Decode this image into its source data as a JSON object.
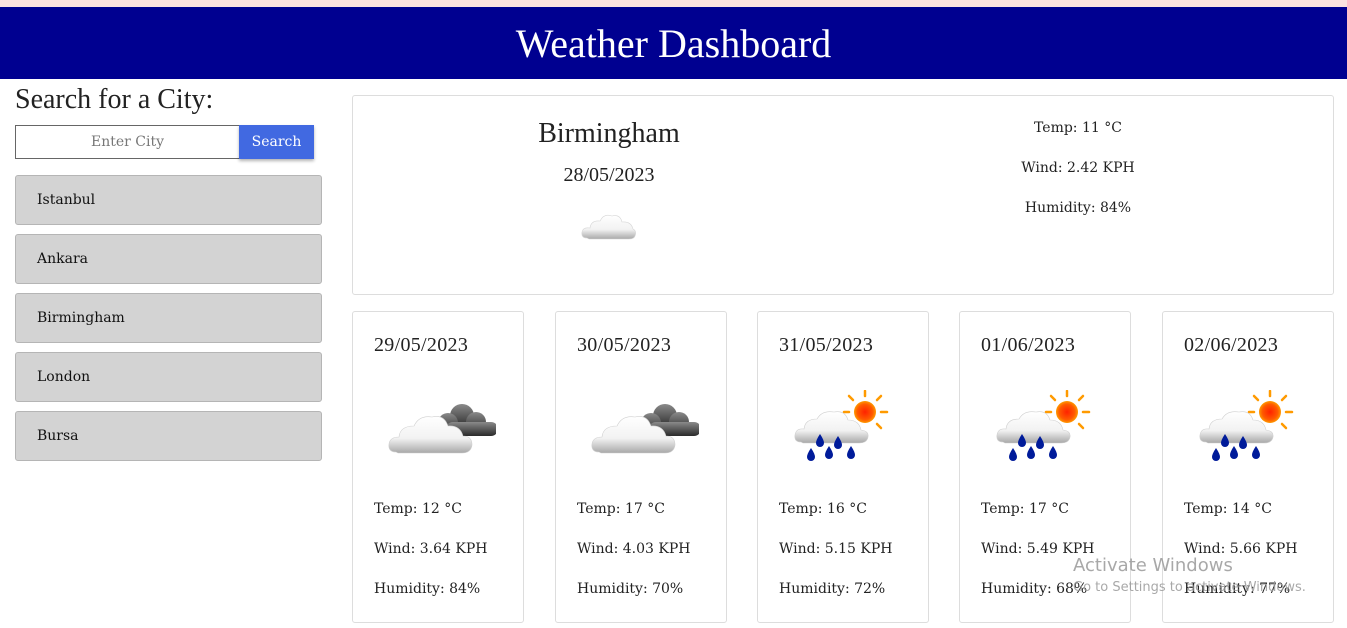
{
  "header": {
    "title": "Weather Dashboard"
  },
  "sidebar": {
    "title": "Search for a City:",
    "search": {
      "placeholder": "Enter City",
      "value": "",
      "button_label": "Search"
    },
    "history": [
      "Istanbul",
      "Ankara",
      "Birmingham",
      "London",
      "Bursa"
    ]
  },
  "current": {
    "city": "Birmingham",
    "date": "28/05/2023",
    "icon": "cloud-icon",
    "temp": "Temp: 11 °C",
    "wind": "Wind: 2.42 KPH",
    "humidity": "Humidity: 84%"
  },
  "forecast": [
    {
      "date": "29/05/2023",
      "icon": "cloudy-icon",
      "temp": "Temp: 12 °C",
      "wind": "Wind: 3.64 KPH",
      "humidity": "Humidity: 84%"
    },
    {
      "date": "30/05/2023",
      "icon": "cloudy-icon",
      "temp": "Temp: 17 °C",
      "wind": "Wind: 4.03 KPH",
      "humidity": "Humidity: 70%"
    },
    {
      "date": "31/05/2023",
      "icon": "rain-sun-icon",
      "temp": "Temp: 16 °C",
      "wind": "Wind: 5.15 KPH",
      "humidity": "Humidity: 72%"
    },
    {
      "date": "01/06/2023",
      "icon": "rain-sun-icon",
      "temp": "Temp: 17 °C",
      "wind": "Wind: 5.49 KPH",
      "humidity": "Humidity: 68%"
    },
    {
      "date": "02/06/2023",
      "icon": "rain-sun-icon",
      "temp": "Temp: 14 °C",
      "wind": "Wind: 5.66 KPH",
      "humidity": "Humidity: 77%"
    }
  ],
  "watermark": {
    "title": "Activate Windows",
    "subtitle": "Go to Settings to activate Windows."
  },
  "colors": {
    "header": "#000090",
    "search_button": "#4169e1",
    "history_item": "#d3d3d3"
  }
}
